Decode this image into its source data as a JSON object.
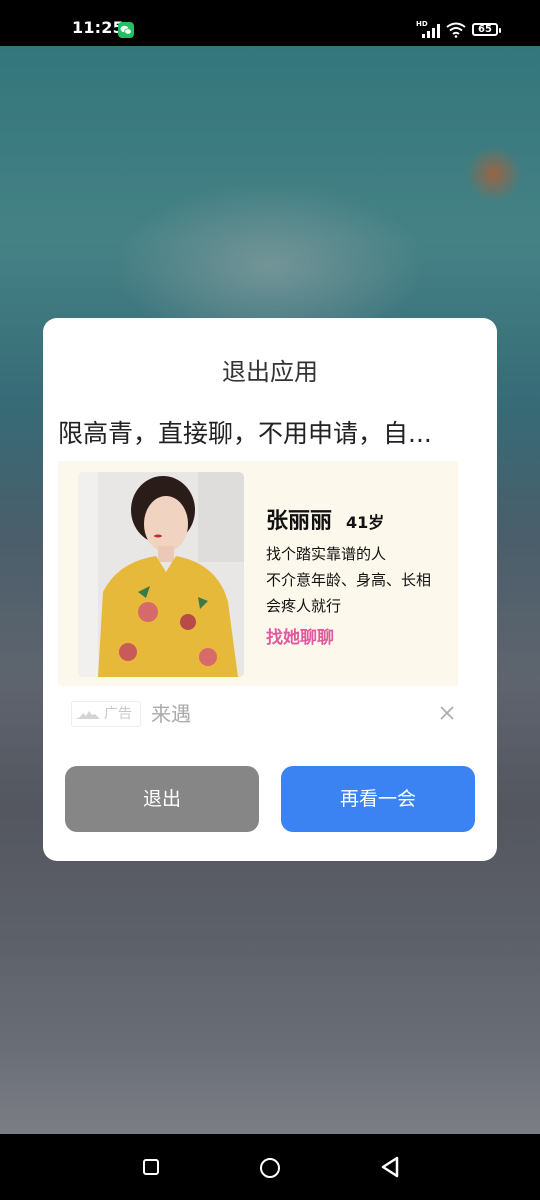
{
  "status_bar": {
    "time": "11:25",
    "battery": "65",
    "icons": [
      "wechat-icon",
      "hd-icon",
      "signal-icon",
      "wifi-icon",
      "battery-icon"
    ]
  },
  "dialog": {
    "title": "退出应用",
    "ad": {
      "headline": "限高青，直接聊，不用申请，自...",
      "name": "张丽丽",
      "age": "41岁",
      "lines": [
        "找个踏实靠谱的人",
        "不介意年龄、身高、长相",
        "会疼人就行"
      ],
      "cta": "找她聊聊",
      "badge": "广告",
      "source": "来遇",
      "cta_color": "#e15aa0"
    },
    "buttons": {
      "exit": "退出",
      "stay": "再看一会"
    },
    "colors": {
      "exit_button": "#868686",
      "stay_button": "#3b82f2"
    }
  },
  "nav_bar": {
    "icons": [
      "recent-apps-icon",
      "home-icon",
      "back-icon"
    ]
  }
}
